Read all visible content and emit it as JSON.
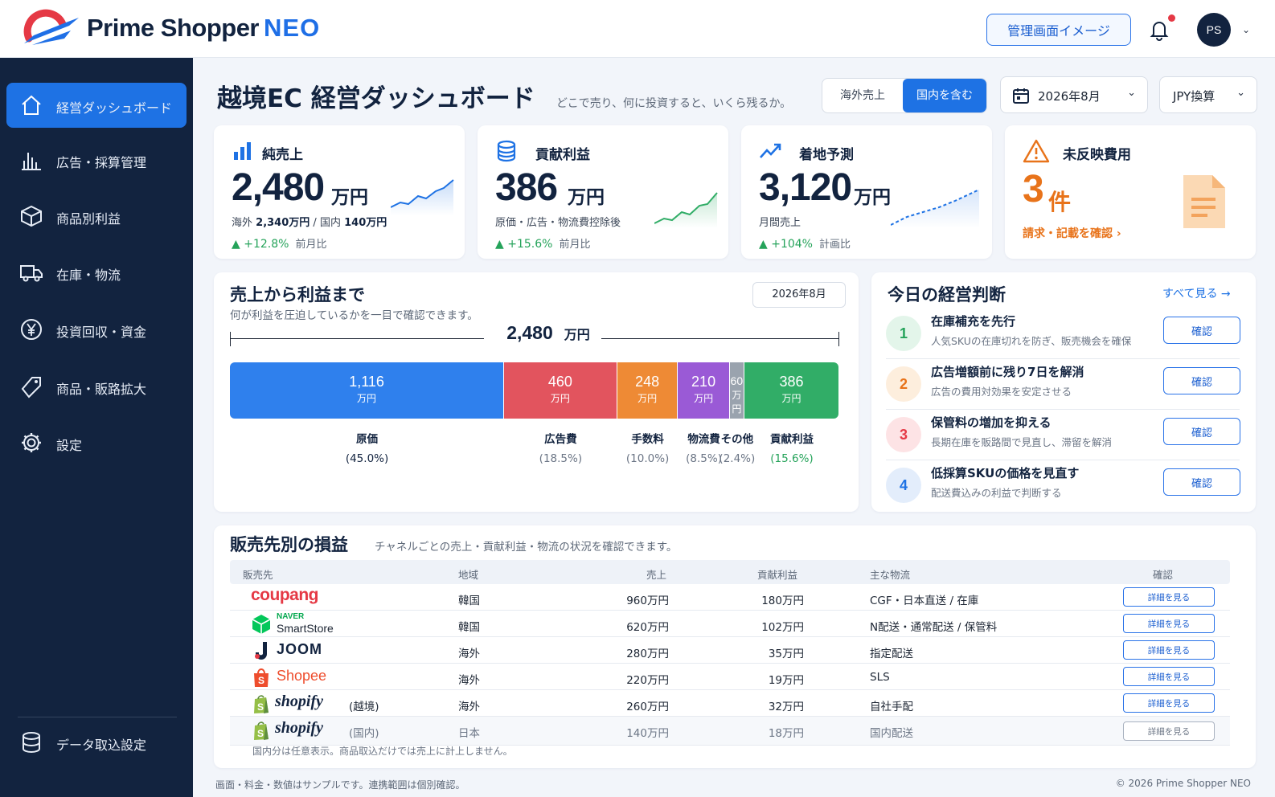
{
  "app": {
    "brand_main": "Prime Shopper",
    "brand_accent": "NEO",
    "admin_button": "管理画面イメージ",
    "avatar_initials": "PS"
  },
  "colors": {
    "primary": "#1e72e4",
    "sidebar": "#12233f",
    "positive": "#25a35a",
    "warning": "#e8731a"
  },
  "sidebar": {
    "items": [
      {
        "label": "経営ダッシュボード",
        "icon": "home-icon",
        "active": true
      },
      {
        "label": "広告・採算管理",
        "icon": "bar-chart-icon"
      },
      {
        "label": "商品別利益",
        "icon": "box-icon"
      },
      {
        "label": "在庫・物流",
        "icon": "truck-icon"
      },
      {
        "label": "投資回収・資金",
        "icon": "yen-icon"
      },
      {
        "label": "商品・販路拡大",
        "icon": "tag-icon"
      },
      {
        "label": "設定",
        "icon": "gear-icon"
      }
    ],
    "footer_item": {
      "label": "データ取込設定",
      "icon": "database-icon"
    }
  },
  "header": {
    "title": "越境EC 経営ダッシュボード",
    "subtitle": "どこで売り、何に投資すると、いくら残るか。",
    "toggle": {
      "off": "海外売上",
      "on": "国内を含む"
    },
    "period": "2026年8月",
    "currency": "JPY換算"
  },
  "kpis": [
    {
      "title": "純売上",
      "value": "2,480",
      "unit": "万円",
      "sub_a": "海外",
      "sub_a_val": "2,340万円",
      "sub_sep": "/",
      "sub_b": "国内",
      "sub_b_val": "140万円",
      "delta": "+12.8%",
      "delta_label": "前月比",
      "icon": "bar-chart-icon"
    },
    {
      "title": "貢献利益",
      "value": "386",
      "unit": "万円",
      "sub": "原価・広告・物流費控除後",
      "delta": "+15.6%",
      "delta_label": "前月比",
      "icon": "coins-icon"
    },
    {
      "title": "着地予測",
      "value": "3,120",
      "unit": "万円",
      "sub": "月間売上",
      "delta": "+104%",
      "delta_label": "計画比",
      "icon": "trend-up-icon"
    },
    {
      "title": "未反映費用",
      "value": "3",
      "unit": "件",
      "link": "請求・記載を確認",
      "icon": "warning-icon"
    }
  ],
  "waterfall": {
    "title": "売上から利益まで",
    "subtitle": "何が利益を圧迫しているかを一目で確認できます。",
    "period": "2026年8月",
    "total": "2,480",
    "total_unit": "万円",
    "unit": "万円",
    "segments": [
      {
        "value": "1,116",
        "label": "原価",
        "pct": "(45.0%)",
        "color": "#2f80ed"
      },
      {
        "value": "460",
        "label": "広告費",
        "pct": "(18.5%)",
        "color": "#e2545e"
      },
      {
        "value": "248",
        "label": "手数料",
        "pct": "(10.0%)",
        "color": "#ee8a35"
      },
      {
        "value": "210",
        "label": "物流費",
        "pct": "(8.5%)",
        "color": "#9a5ad6"
      },
      {
        "value": "60",
        "label": "その他",
        "pct": "(2.4%)",
        "color": "#9aa3ae"
      },
      {
        "value": "386",
        "label": "貢献利益",
        "pct": "(15.6%)",
        "color": "#31ad67"
      }
    ]
  },
  "decisions": {
    "title": "今日の経営判断",
    "see_all": "すべて見る",
    "button": "確認",
    "items": [
      {
        "num": "1",
        "title": "在庫補充を先行",
        "desc": "人気SKUの在庫切れを防ぎ、販売機会を確保"
      },
      {
        "num": "2",
        "title": "広告増額前に残り7日を解消",
        "desc": "広告の費用対効果を安定させる"
      },
      {
        "num": "3",
        "title": "保管料の増加を抑える",
        "desc": "長期在庫を販路間で見直し、滞留を解消"
      },
      {
        "num": "4",
        "title": "低採算SKUの価格を見直す",
        "desc": "配送費込みの利益で判断する"
      }
    ]
  },
  "channels": {
    "title": "販売先別の損益",
    "subtitle": "チャネルごとの売上・貢献利益・物流の状況を確認できます。",
    "columns": [
      "販売先",
      "地域",
      "売上",
      "貢献利益",
      "主な物流",
      "確認"
    ],
    "button": "詳細を見る",
    "rows": [
      {
        "channel": "coupang",
        "region": "韓国",
        "sales": "960万円",
        "profit": "180万円",
        "logistics": "CGF・日本直送 / 在庫"
      },
      {
        "channel": "NAVER SmartStore",
        "channel_top": "NAVER",
        "channel_bottom": "SmartStore",
        "region": "韓国",
        "sales": "620万円",
        "profit": "102万円",
        "logistics": "N配送・通常配送 / 保管料"
      },
      {
        "channel": "JOOM",
        "region": "海外",
        "sales": "280万円",
        "profit": "35万円",
        "logistics": "指定配送"
      },
      {
        "channel": "Shopee",
        "region": "海外",
        "sales": "220万円",
        "profit": "19万円",
        "logistics": "SLS"
      },
      {
        "channel": "shopify",
        "tag": "(越境)",
        "region": "海外",
        "sales": "260万円",
        "profit": "32万円",
        "logistics": "自社手配"
      },
      {
        "channel": "shopify",
        "tag": "(国内)",
        "region": "日本",
        "sales": "140万円",
        "profit": "18万円",
        "logistics": "国内配送"
      }
    ],
    "note": "国内分は任意表示。商品取込だけでは売上に計上しません。"
  },
  "footer": {
    "left": "画面・料金・数値はサンプルです。連携範囲は個別確認。",
    "right": "© 2026 Prime Shopper NEO"
  }
}
